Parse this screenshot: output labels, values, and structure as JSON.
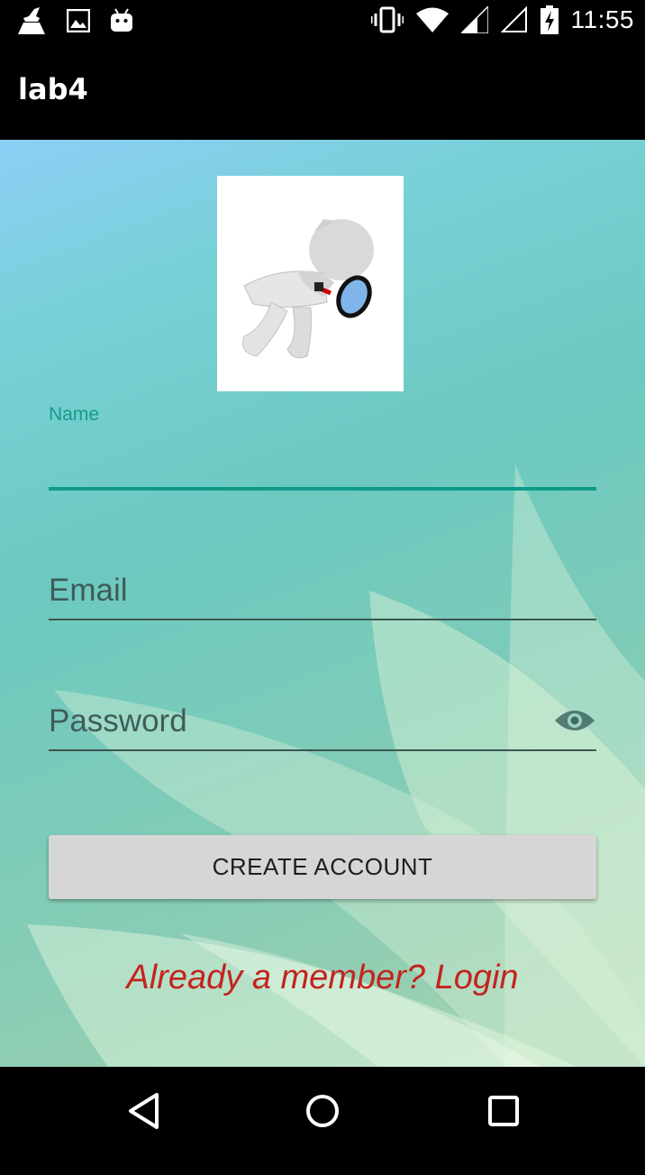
{
  "status_bar": {
    "time": "11:55",
    "left_icons": [
      "cleaner-icon",
      "image-icon",
      "android-icon"
    ],
    "right_icons": [
      "vibrate-icon",
      "wifi-icon",
      "signal-icon",
      "signal-empty-icon",
      "battery-charging-icon"
    ]
  },
  "app_bar": {
    "title": "lab4"
  },
  "form": {
    "name_label": "Name",
    "name_value": "",
    "email_placeholder": "Email",
    "password_placeholder": "Password",
    "create_button_label": "CREATE ACCOUNT",
    "login_link": "Already a member? Login"
  },
  "colors": {
    "accent": "#0f9a89",
    "link": "#c4231f",
    "button_bg": "#d6d6d6"
  },
  "nav_bar": {
    "buttons": [
      "back-icon",
      "home-icon",
      "recents-icon"
    ]
  }
}
